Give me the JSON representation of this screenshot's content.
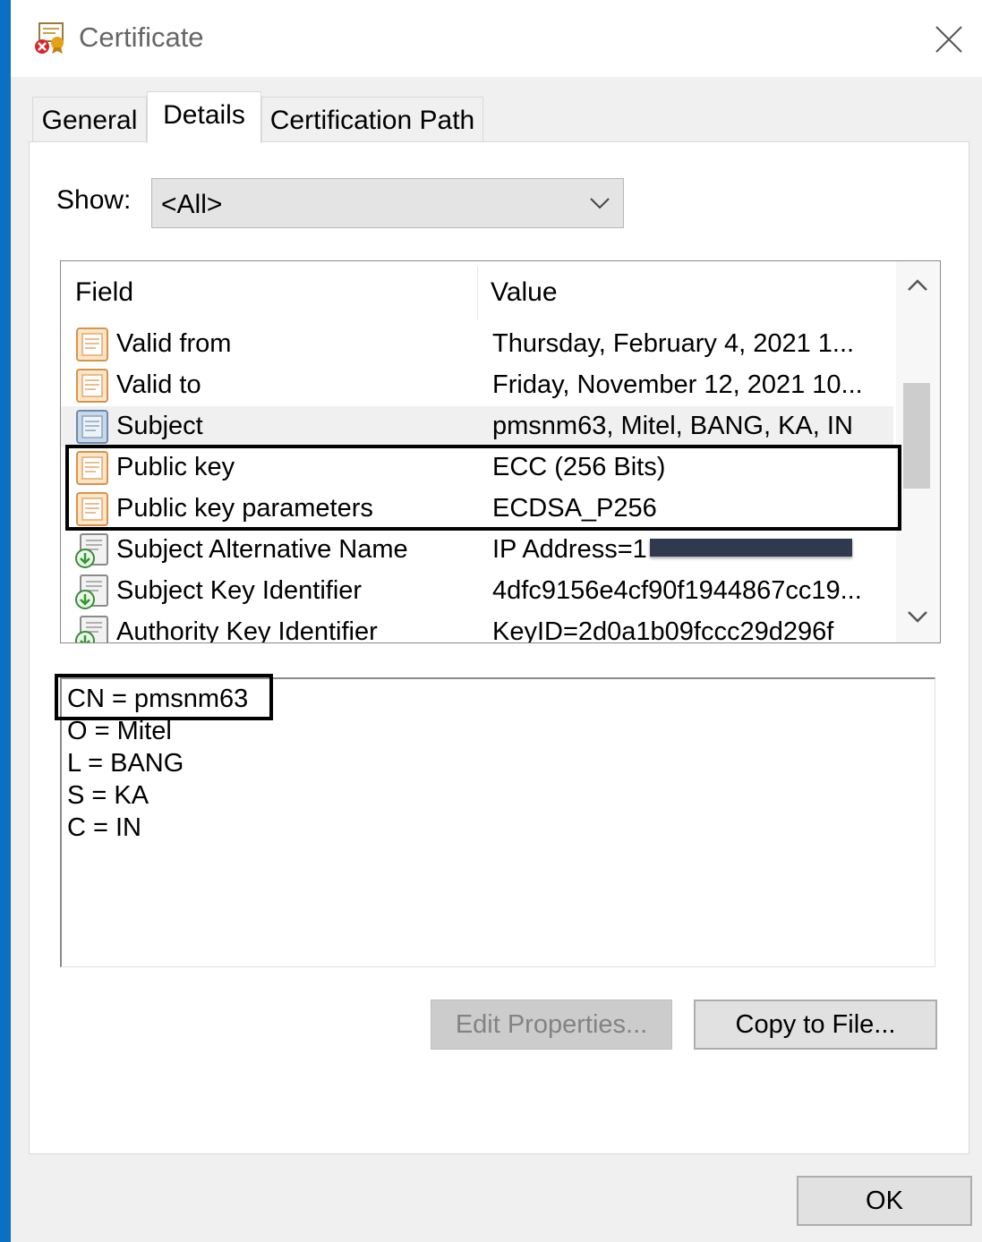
{
  "window": {
    "title": "Certificate",
    "icon": "certificate-error-icon"
  },
  "tabs": [
    {
      "label": "General",
      "active": false
    },
    {
      "label": "Details",
      "active": true
    },
    {
      "label": "Certification Path",
      "active": false
    }
  ],
  "show": {
    "label": "Show:",
    "value": "<All>"
  },
  "list": {
    "columns": {
      "field": "Field",
      "value": "Value"
    },
    "rows": [
      {
        "field": "Valid from",
        "value": "Thursday, February 4, 2021 1...",
        "icon": "property-icon"
      },
      {
        "field": "Valid to",
        "value": "Friday, November 12, 2021 10...",
        "icon": "property-icon"
      },
      {
        "field": "Subject",
        "value": "pmsnm63, Mitel, BANG, KA, IN",
        "icon": "property-icon",
        "selected": true
      },
      {
        "field": "Public key",
        "value": "ECC (256 Bits)",
        "icon": "property-icon"
      },
      {
        "field": "Public key parameters",
        "value": "ECDSA_P256",
        "icon": "property-icon"
      },
      {
        "field": "Subject Alternative Name",
        "value": "IP Address=1",
        "icon": "extension-icon"
      },
      {
        "field": "Subject Key Identifier",
        "value": "4dfc9156e4cf90f1944867cc19...",
        "icon": "extension-icon"
      },
      {
        "field": "Authority Key Identifier",
        "value": "KeyID=2d0a1b09fccc29d296f",
        "icon": "extension-icon"
      }
    ]
  },
  "detail": {
    "lines": [
      "CN = pmsnm63",
      "O = Mitel",
      "L = BANG",
      "S = KA",
      "C = IN"
    ]
  },
  "buttons": {
    "edit_properties": "Edit Properties...",
    "copy_to_file": "Copy to File...",
    "ok": "OK"
  },
  "colors": {
    "accent": "#0b6fc4",
    "dialog_bg": "#f0f0f0",
    "redaction": "#2f3a4f"
  }
}
